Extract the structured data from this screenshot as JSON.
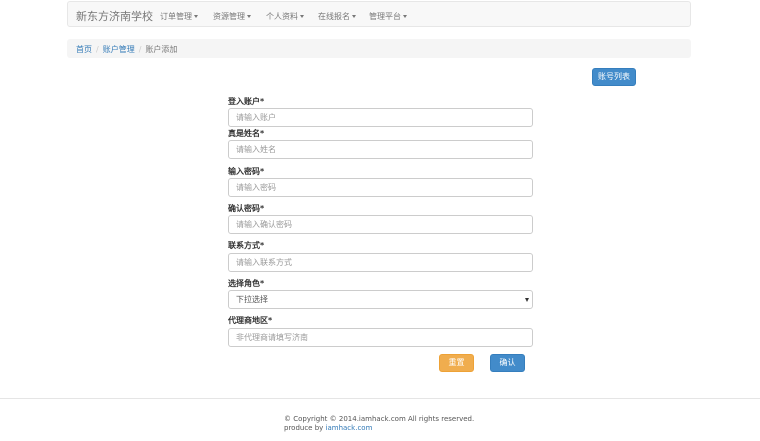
{
  "navbar": {
    "brand": "新东方济南学校",
    "items": [
      {
        "label": "订单管理"
      },
      {
        "label": "资源管理"
      },
      {
        "label": "个人资料"
      },
      {
        "label": "在线报名"
      },
      {
        "label": "管理平台"
      }
    ]
  },
  "breadcrumb": {
    "items": [
      "首页",
      "账户管理",
      "账户添加"
    ],
    "separator": "/"
  },
  "actions": {
    "list_button": "账号列表",
    "reset_button": "重置",
    "confirm_button": "确认"
  },
  "form": {
    "fields": [
      {
        "label": "登入账户*",
        "placeholder": "请输入账户"
      },
      {
        "label": "真是姓名*",
        "placeholder": "请输入姓名"
      },
      {
        "label": "输入密码*",
        "placeholder": "请输入密码"
      },
      {
        "label": "确认密码*",
        "placeholder": "请输入确认密码"
      },
      {
        "label": "联系方式*",
        "placeholder": "请输入联系方式"
      },
      {
        "label": "选择角色*",
        "selected": "下拉选择"
      },
      {
        "label": "代理商地区*",
        "placeholder": "非代理商请填写济南"
      }
    ]
  },
  "footer": {
    "copyright": "© Copyright © 2014.iamhack.com All rights reserved.",
    "produce_prefix": "produce by",
    "produce_link": "iamhack.com"
  },
  "colors": {
    "primary": "#428bca",
    "warning": "#f0ad4e",
    "link": "#337ab7"
  }
}
